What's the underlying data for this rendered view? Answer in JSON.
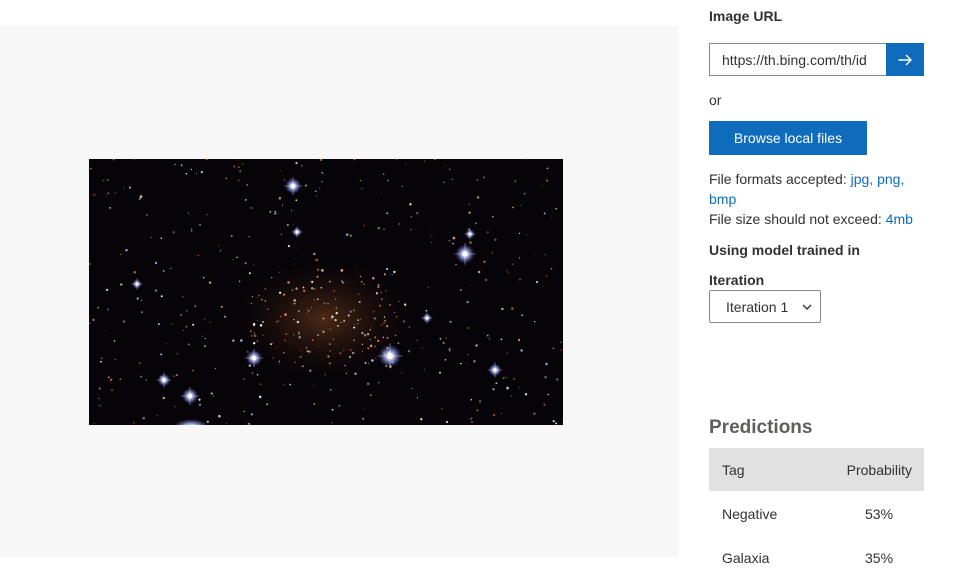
{
  "upload": {
    "image_url_label": "Image URL",
    "image_url_value": "https://th.bing.com/th/id",
    "submit_icon": "arrow-right-icon",
    "or_text": "or",
    "browse_label": "Browse local files",
    "formats_prefix": "File formats accepted: ",
    "formats_value": "jpg, png, bmp",
    "size_prefix": "File size should not exceed: ",
    "size_value": "4mb"
  },
  "model": {
    "trained_label": "Using model trained in",
    "iteration_label": "Iteration",
    "iteration_selected": "Iteration 1"
  },
  "predictions": {
    "title": "Predictions",
    "columns": [
      "Tag",
      "Probability"
    ],
    "rows": [
      {
        "tag": "Negative",
        "probability": "53%"
      },
      {
        "tag": "Galaxia",
        "probability": "35%"
      }
    ]
  },
  "colors": {
    "accent": "#0f6cbd",
    "preview_background": "#f7f7f7",
    "table_header": "#e1e1e1"
  }
}
